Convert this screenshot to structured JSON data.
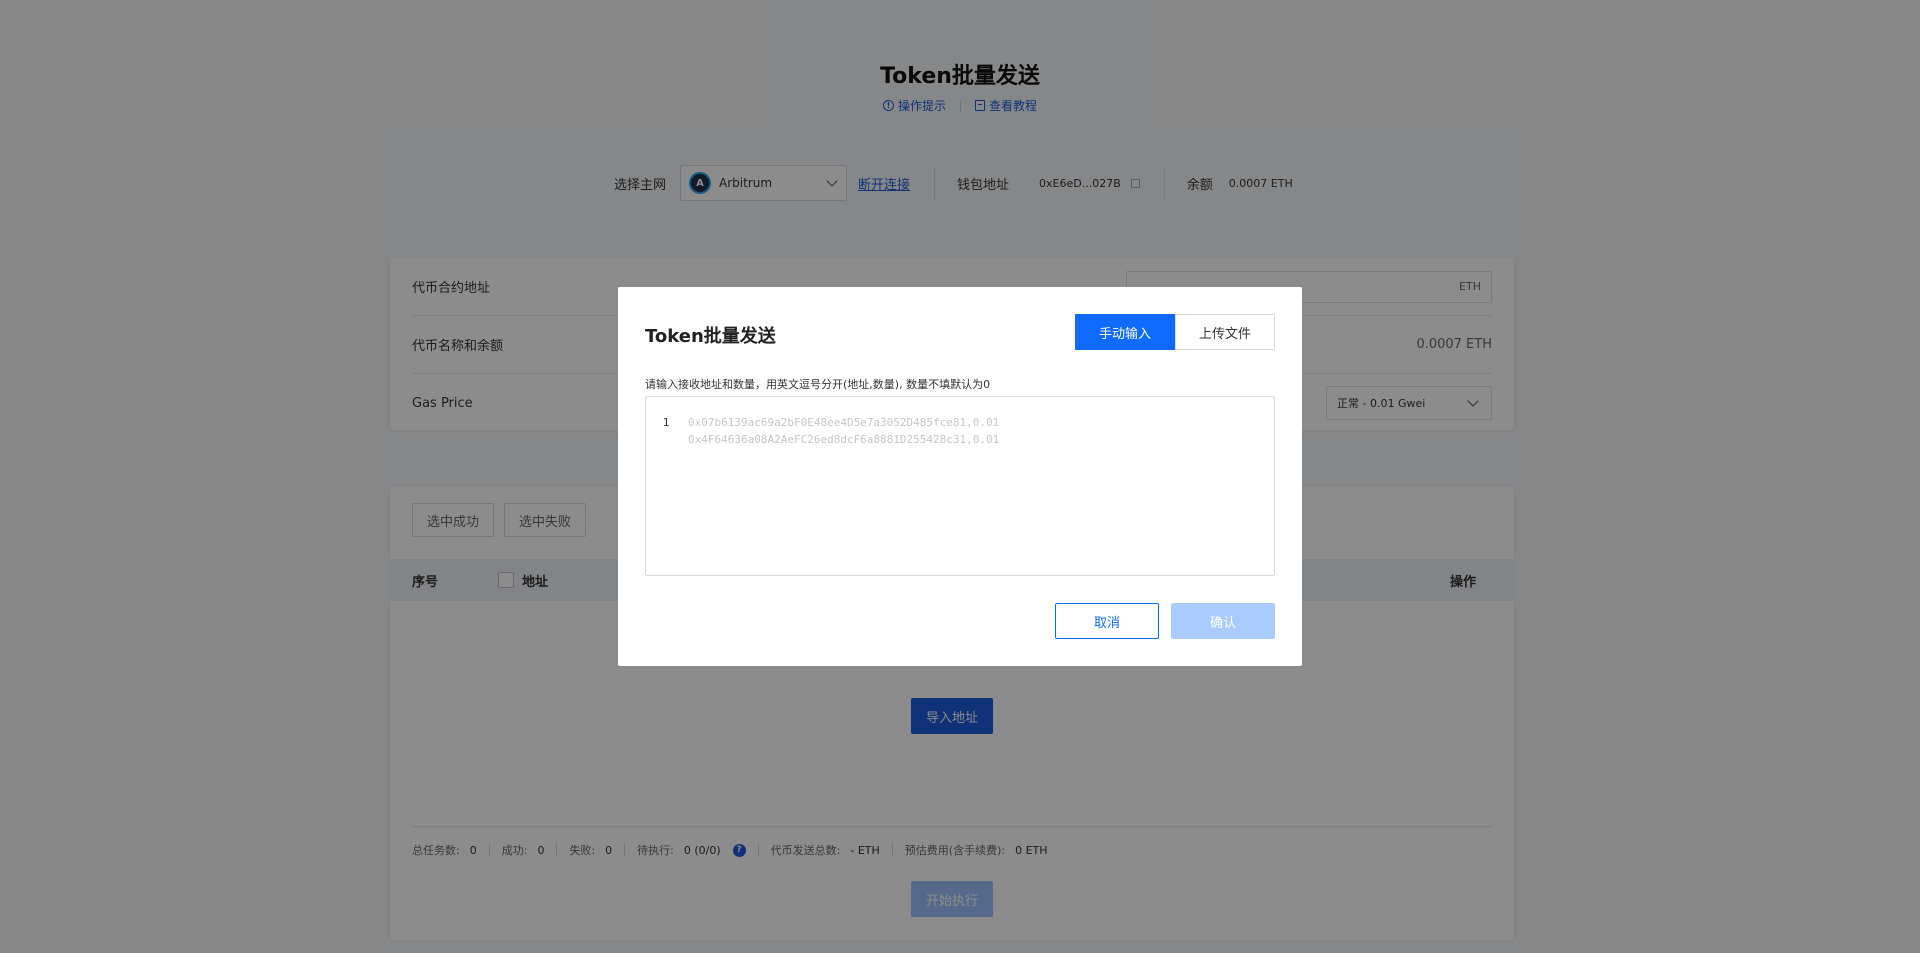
{
  "header": {
    "title": "Token批量发送",
    "link_tips": "操作提示",
    "link_tutorial": "查看教程"
  },
  "network": {
    "label": "选择主网",
    "selected": "Arbitrum",
    "disconnect": "断开连接",
    "wallet_label": "钱包地址",
    "wallet_address": "0xE6eD...027B",
    "balance_label": "余额",
    "balance_value": "0.0007 ETH"
  },
  "form": {
    "contract_label": "代币合约地址",
    "contract_value": "ETH",
    "name_balance_label": "代币名称和余额",
    "name_balance_value": "0.0007 ETH",
    "gas_label": "Gas Price",
    "gas_value": "正常 - 0.01 Gwei"
  },
  "table": {
    "filter_success": "选中成功",
    "filter_fail": "选中失败",
    "col_index": "序号",
    "col_address": "地址",
    "col_ops": "操作",
    "import_button": "导入地址",
    "start_button": "开始执行"
  },
  "stats": {
    "total_label": "总任务数:",
    "total": "0",
    "success_label": "成功:",
    "success": "0",
    "fail_label": "失败:",
    "fail": "0",
    "pending_label": "待执行:",
    "pending": "0 (0/0)",
    "sent_label": "代币发送总数:",
    "sent": "- ETH",
    "fee_label": "预估费用(含手续费):",
    "fee": "0 ETH"
  },
  "modal": {
    "title": "Token批量发送",
    "tab_manual": "手动输入",
    "tab_upload": "上传文件",
    "hint": "请输入接收地址和数量，用英文逗号分开(地址,数量), 数量不填默认为0",
    "line_number": "1",
    "placeholder_line1": "0x07b6139ac69a2bF0E48ee4D5e7a3052D485fce81,0.01",
    "placeholder_line2": "0x4F64636a08A2AeFC26ed8dcF6a8881D255428c31,0.01",
    "cancel": "取消",
    "confirm": "确认"
  }
}
